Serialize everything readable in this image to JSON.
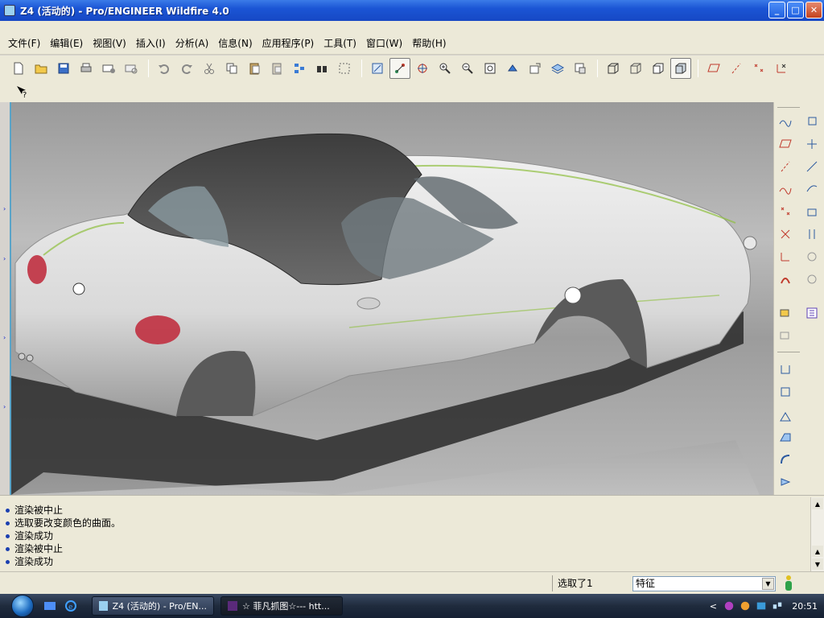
{
  "window": {
    "title": "Z4 (活动的) - Pro/ENGINEER Wildfire 4.0",
    "minimize_glyph": "_",
    "maximize_glyph": "□",
    "close_glyph": "✕"
  },
  "menu": {
    "items": [
      {
        "label": "文件(F)",
        "icon": "file-menu"
      },
      {
        "label": "编辑(E)",
        "icon": "edit-menu"
      },
      {
        "label": "视图(V)",
        "icon": "view-menu"
      },
      {
        "label": "插入(I)",
        "icon": "insert-menu"
      },
      {
        "label": "分析(A)",
        "icon": "analysis-menu"
      },
      {
        "label": "信息(N)",
        "icon": "info-menu"
      },
      {
        "label": "应用程序(P)",
        "icon": "applications-menu"
      },
      {
        "label": "工具(T)",
        "icon": "tools-menu"
      },
      {
        "label": "窗口(W)",
        "icon": "window-menu"
      },
      {
        "label": "帮助(H)",
        "icon": "help-menu"
      }
    ]
  },
  "toolbar": {
    "icons": [
      "new-file-icon",
      "open-folder-icon",
      "save-icon",
      "print-icon",
      "email-icon",
      "email-attach-icon",
      "undo-icon",
      "redo-icon",
      "cut-icon",
      "copy-icon",
      "paste-icon",
      "paste-special-icon",
      "regenerate-icon",
      "find-icon",
      "select-box-icon",
      "view-sketch-icon",
      "pan-icon",
      "spin-center-icon",
      "zoom-in-icon",
      "zoom-out-icon",
      "refit-icon",
      "reorient-icon",
      "saved-views-icon",
      "layers-icon",
      "view-manager-icon",
      "wireframe-icon",
      "hidden-line-icon",
      "no-hidden-icon",
      "shading-icon",
      "datum-planes-icon",
      "datum-axes-icon",
      "datum-points-icon",
      "coord-sys-icon"
    ],
    "whats_this_icon": "whats-this-icon"
  },
  "right_toolbar": {
    "icons": [
      "sketch-curve-icon",
      "datum-plane-icon",
      "datum-axis-icon",
      "datum-curve-icon",
      "datum-point-icon",
      "coordinate-system-icon",
      "analysis-feature-icon",
      "copy-feature-icon",
      "mirror-icon",
      "extrude-icon",
      "revolve-icon",
      "sweep-icon",
      "blend-icon",
      "fill-icon",
      "pattern-icon",
      "hole-icon",
      "shell-icon",
      "rib-icon",
      "draft-icon",
      "round-icon",
      "chamfer-icon",
      "merge-icon",
      "trim-icon",
      "intersect-icon",
      "group-icon",
      "boundary-icon"
    ]
  },
  "messages": [
    "渲染被中止",
    "选取要改变颜色的曲面。",
    "渲染成功",
    "渲染被中止",
    "渲染成功"
  ],
  "status": {
    "selection": "选取了1",
    "filter_value": "特征",
    "filter_dropdown_glyph": "▼"
  },
  "taskbar": {
    "tasks": [
      {
        "label": "Z4 (活动的) - Pro/EN...",
        "active": false
      },
      {
        "label": "☆ 菲凡抓图☆--- htt...",
        "active": true
      }
    ],
    "clock": "20:51",
    "tray_arrow": "<"
  },
  "colors": {
    "title_bar": "#1b55d5",
    "chrome": "#ece9d8",
    "taillight": "#c03040",
    "soft_top": "#4a4a4a",
    "body_paint": "#e6e6e6",
    "accent_green": "#8fbf3f"
  }
}
